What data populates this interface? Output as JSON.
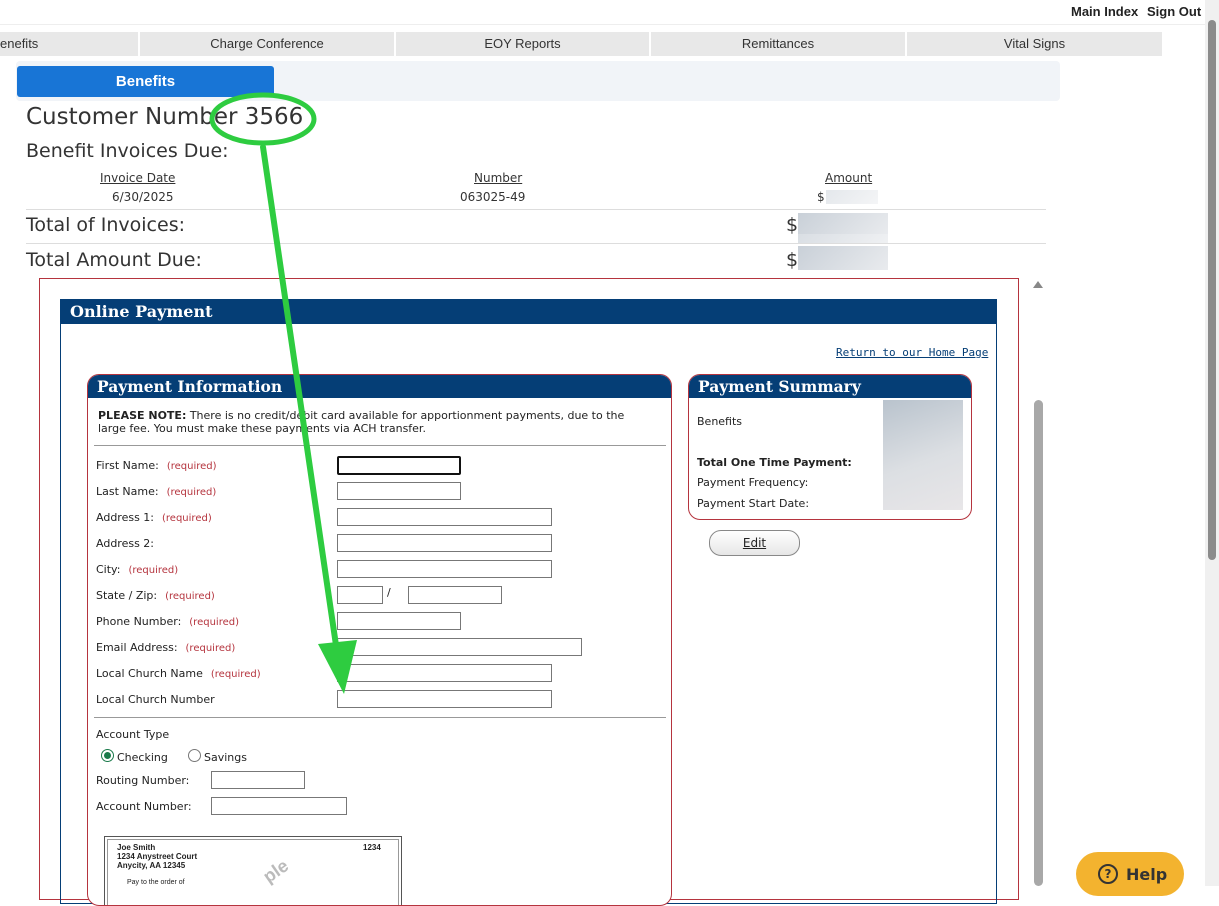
{
  "top_links": {
    "main_index": "Main Index",
    "sign_out": "Sign Out"
  },
  "nav": [
    "enefits",
    "Charge Conference",
    "EOY Reports",
    "Remittances",
    "Vital Signs"
  ],
  "tab": "Benefits",
  "customer": {
    "label": "Customer Number",
    "number": "3566"
  },
  "invoices_heading": "Benefit Invoices Due:",
  "invoice_table": {
    "headers": [
      "Invoice Date",
      "Number",
      "Amount"
    ],
    "row": {
      "date": "6/30/2025",
      "number": "063025-49",
      "amount": "$"
    }
  },
  "totals": {
    "invoices_label": "Total of Invoices:",
    "due_label": "Total Amount Due:",
    "currency": "$"
  },
  "online_payment": {
    "title": "Online Payment",
    "home_link": "Return to our Home Page",
    "info_title": "Payment Information",
    "note_bold": "PLEASE NOTE:",
    "note_text": " There is no credit/debit card available for apportionment payments, due to the large fee.  You must make these payments via ACH transfer.",
    "required_text": "(required)",
    "fields": {
      "first_name": "First Name:",
      "last_name": "Last Name:",
      "address1": "Address 1:",
      "address2": "Address 2:",
      "city": "City:",
      "state_zip": "State / Zip:",
      "zip_sep": "/",
      "phone": "Phone Number:",
      "email": "Email Address:",
      "church_name": "Local Church Name",
      "church_number": "Local Church Number"
    },
    "account_type_label": "Account Type",
    "checking": "Checking",
    "savings": "Savings",
    "selected_account_type": "Checking",
    "routing_label": "Routing Number:",
    "account_label": "Account Number:",
    "check_sample": {
      "name": "Joe Smith",
      "street": "1234 Anystreet Court",
      "city": "Anycity, AA 12345",
      "check_no": "1234",
      "pay_to": "Pay to the order of",
      "watermark": "ple"
    }
  },
  "summary": {
    "title": "Payment Summary",
    "benefits": "Benefits",
    "total": "Total One Time Payment:",
    "frequency": "Payment Frequency:",
    "start": "Payment Start Date:",
    "edit": "Edit"
  },
  "help": {
    "label": "Help",
    "icon": "question-circle-icon"
  },
  "annotation": {
    "color": "#2ecc40"
  }
}
